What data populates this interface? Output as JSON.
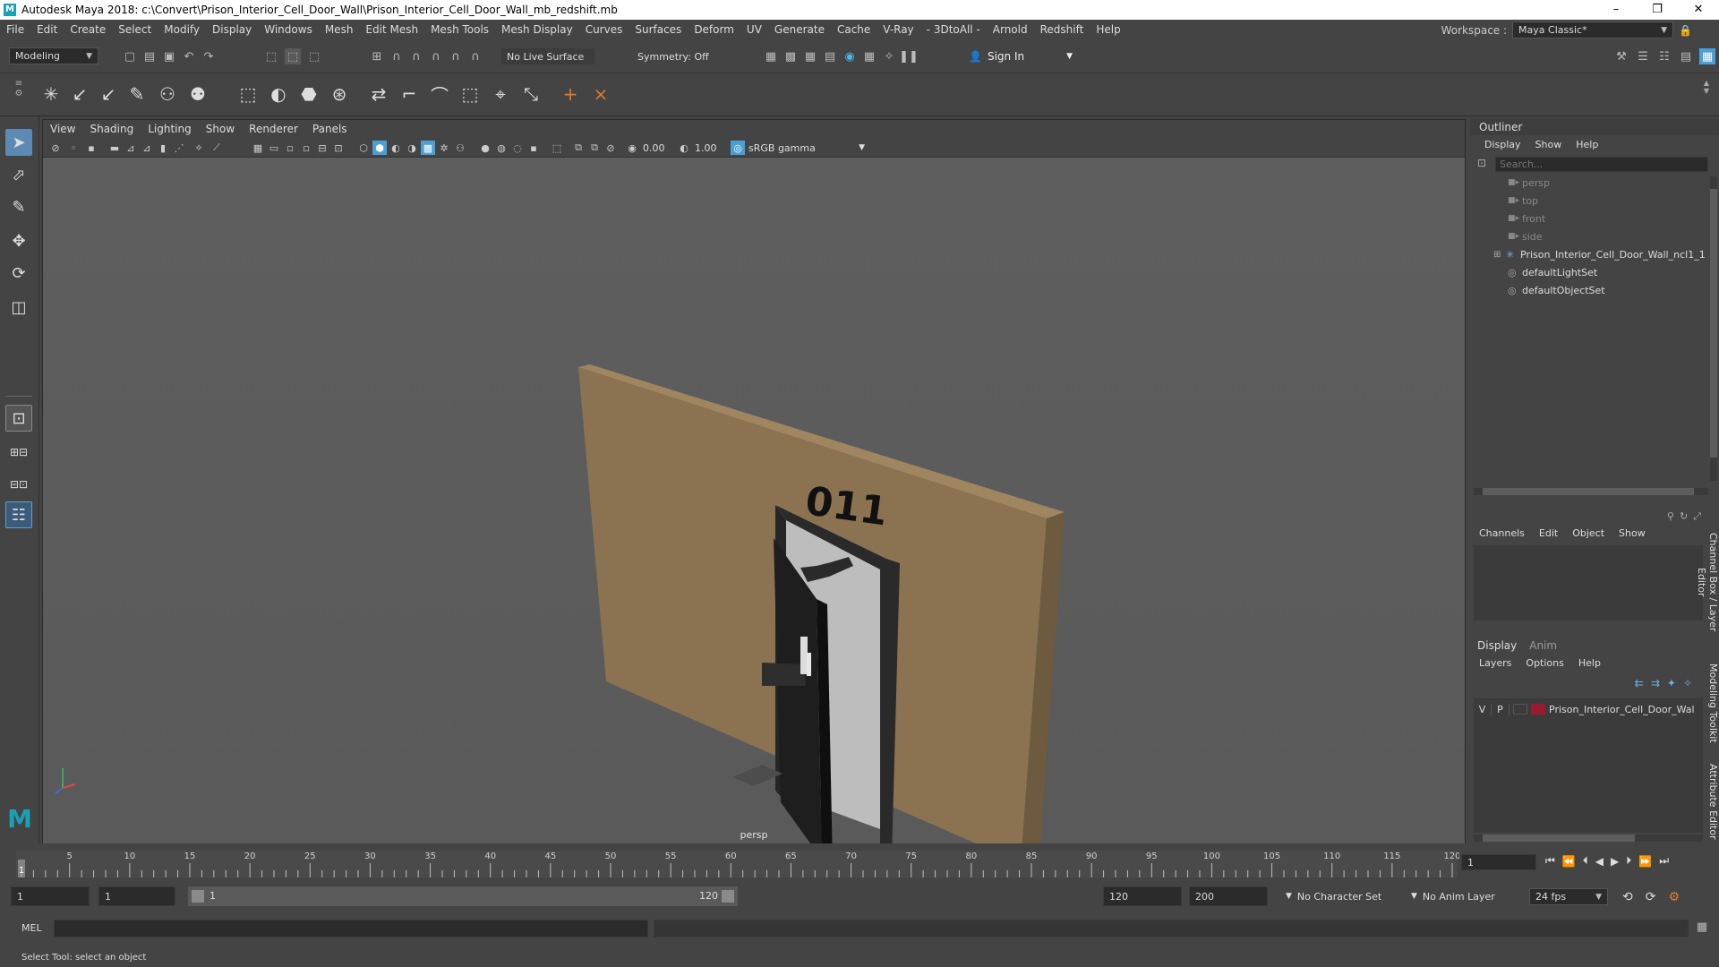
{
  "titlebar": {
    "title": "Autodesk Maya 2018: c:\\Convert\\Prison_Interior_Cell_Door_Wall\\Prison_Interior_Cell_Door_Wall_mb_redshift.mb",
    "minimize": "–",
    "maximize": "❐",
    "close": "✕"
  },
  "menubar": {
    "items": [
      "File",
      "Edit",
      "Create",
      "Select",
      "Modify",
      "Display",
      "Windows",
      "Mesh",
      "Edit Mesh",
      "Mesh Tools",
      "Mesh Display",
      "Curves",
      "Surfaces",
      "Deform",
      "UV",
      "Generate",
      "Cache",
      "V-Ray",
      "- 3DtoAll -",
      "Arnold",
      "Redshift",
      "Help"
    ],
    "workspace_label": "Workspace :",
    "workspace_value": "Maya Classic*"
  },
  "statusline": {
    "mode": "Modeling",
    "live_surface": "No Live Surface",
    "symmetry": "Symmetry: Off",
    "sign_in": "Sign In"
  },
  "viewport": {
    "menu": [
      "View",
      "Shading",
      "Lighting",
      "Show",
      "Renderer",
      "Panels"
    ],
    "exposure": "0.00",
    "gamma": "1.00",
    "color_space": "sRGB gamma",
    "camera_label": "persp",
    "door_number": "011"
  },
  "outliner": {
    "title": "Outliner",
    "menu": [
      "Display",
      "Show",
      "Help"
    ],
    "search_placeholder": "Search...",
    "items": [
      {
        "label": "persp",
        "icon": "camera-icon",
        "dim": true
      },
      {
        "label": "top",
        "icon": "camera-icon",
        "dim": true
      },
      {
        "label": "front",
        "icon": "camera-icon",
        "dim": true
      },
      {
        "label": "side",
        "icon": "camera-icon",
        "dim": true
      },
      {
        "label": "Prison_Interior_Cell_Door_Wall_ncl1_1",
        "icon": "group-icon",
        "dim": false
      },
      {
        "label": "defaultLightSet",
        "icon": "set-icon",
        "dim": false
      },
      {
        "label": "defaultObjectSet",
        "icon": "set-icon",
        "dim": false
      }
    ]
  },
  "channelbox": {
    "menu": [
      "Channels",
      "Edit",
      "Object",
      "Show"
    ],
    "side_tab": "Channel Box / Layer Editor"
  },
  "layer_editor": {
    "tabs": [
      "Display",
      "Anim"
    ],
    "menu": [
      "Layers",
      "Options",
      "Help"
    ],
    "layer": {
      "v": "V",
      "p": "P",
      "name": "Prison_Interior_Cell_Door_Wal",
      "color": "#9b1a2f"
    },
    "side_tabs": [
      "Modeling Toolkit",
      "Attribute Editor"
    ]
  },
  "timeslider": {
    "ticks": [
      "1",
      "5",
      "10",
      "15",
      "20",
      "25",
      "30",
      "35",
      "40",
      "45",
      "50",
      "55",
      "60",
      "65",
      "70",
      "75",
      "80",
      "85",
      "90",
      "95",
      "100",
      "105",
      "110",
      "115",
      "120"
    ],
    "current_frame": "1"
  },
  "rangeslider": {
    "start": "1",
    "playback_start": "1",
    "range_start_label": "1",
    "range_end_label": "120",
    "playback_end": "120",
    "end": "200",
    "character_set": "No Character Set",
    "anim_layer": "No Anim Layer",
    "fps": "24 fps"
  },
  "cmdline": {
    "language": "MEL"
  },
  "helpline": {
    "text": "Select Tool: select an object"
  },
  "colors": {
    "wall": "#8b7352",
    "accent": "#4a9fd6",
    "door": "#1e1e1e"
  }
}
